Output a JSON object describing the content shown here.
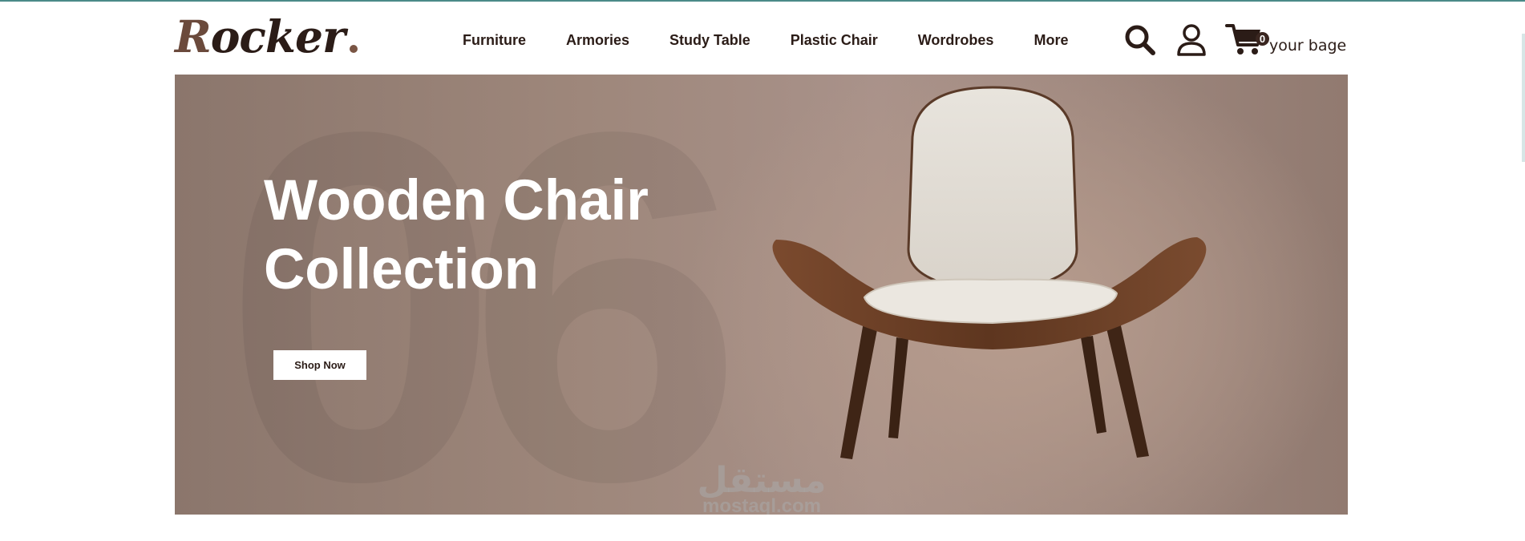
{
  "brand": {
    "first_letter": "R",
    "rest": "ocker"
  },
  "nav": {
    "items": [
      {
        "label": "Furniture"
      },
      {
        "label": "Armories"
      },
      {
        "label": "Study Table"
      },
      {
        "label": "Plastic Chair"
      },
      {
        "label": "Wordrobes"
      },
      {
        "label": "More"
      }
    ]
  },
  "header_icons": {
    "search": "search-icon",
    "account": "user-icon",
    "cart": "cart-icon",
    "cart_count": "0",
    "cart_label": "your bage"
  },
  "hero": {
    "title_line1": "Wooden Chair",
    "title_line2": "Collection",
    "button_label": "Shop Now",
    "background_number": "06"
  },
  "watermark": {
    "arabic": "مستقل",
    "latin": "mostaql.com"
  },
  "colors": {
    "brand_dark": "#2b1c17",
    "brand_brown": "#6b4a3c",
    "hero_bg": "#9e877b",
    "chair_wood": "#6a3f27",
    "chair_fabric": "#e2ddd5"
  }
}
